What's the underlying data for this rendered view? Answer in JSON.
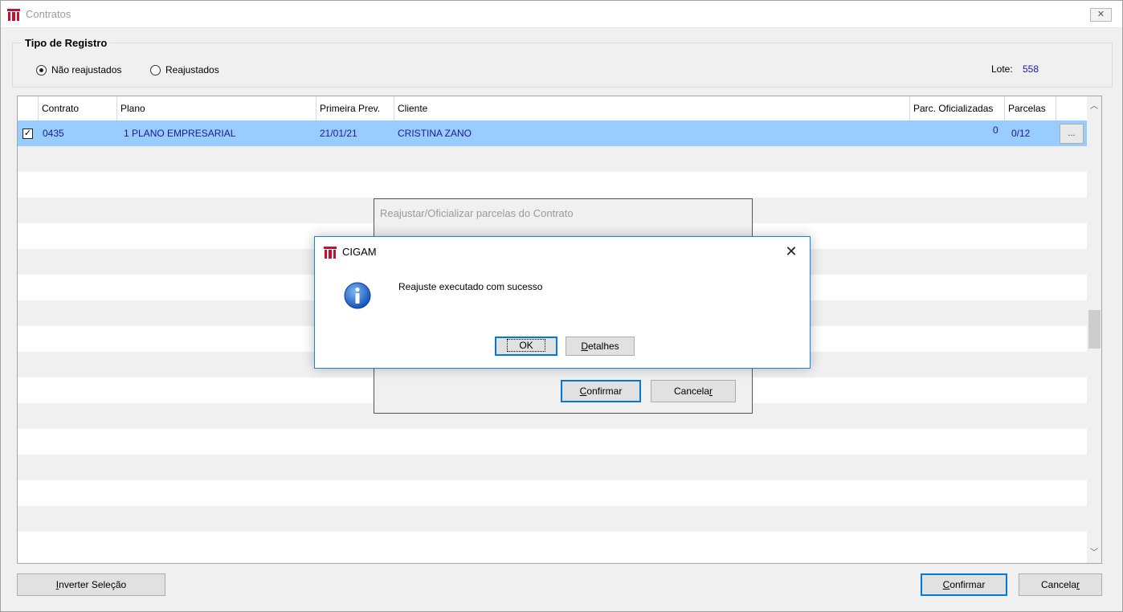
{
  "window": {
    "title": "Contratos",
    "close_glyph": "✕"
  },
  "filter": {
    "group_title": "Tipo de Registro",
    "radio_nao": "Não reajustados",
    "radio_reaj": "Reajustados",
    "lote_label": "Lote:",
    "lote_value": "558"
  },
  "grid": {
    "columns": [
      "Contrato",
      "Plano",
      "Primeira Prev.",
      "Cliente",
      "Parc. Oficializadas",
      "Parcelas"
    ],
    "rows": [
      {
        "checked": true,
        "contrato": "0435",
        "plano": "1 PLANO EMPRESARIAL",
        "primeira_prev": "21/01/21",
        "cliente": "CRISTINA ZANO",
        "parc_oficializadas": "0",
        "parcelas": "0/12",
        "action": "..."
      }
    ]
  },
  "bottom": {
    "invert_a": "I",
    "invert_b": "nverter Seleção",
    "confirm_a": "C",
    "confirm_b": "onfirmar",
    "cancel_a": "Cancela",
    "cancel_b": "r"
  },
  "back_dialog": {
    "title": "Reajustar/Oficializar parcelas do Contrato",
    "confirm_a": "C",
    "confirm_b": "onfirmar",
    "cancel_a": "Cancela",
    "cancel_b": "r"
  },
  "message_box": {
    "title": "CIGAM",
    "message": "Reajuste executado com sucesso",
    "ok": "OK",
    "details_a": "D",
    "details_b": "etalhes",
    "close_glyph": "✕"
  },
  "colors": {
    "selection": "#99ccff",
    "accent": "#0078d7",
    "info": "#1e6fd9",
    "logo_red": "#c8102e"
  }
}
